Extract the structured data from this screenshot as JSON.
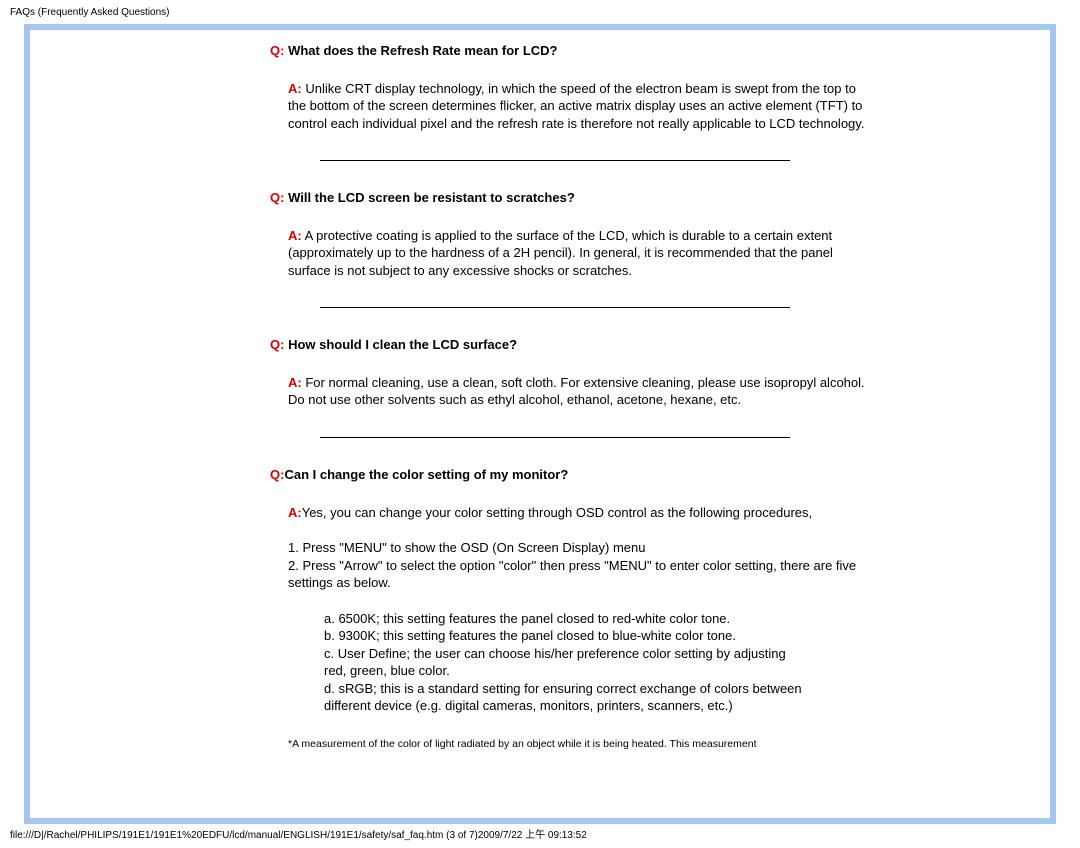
{
  "meta": {
    "top_note": "FAQs (Frequently Asked Questions)",
    "bottom_path": "file:///D|/Rachel/PHILIPS/191E1/191E1%20EDFU/lcd/manual/ENGLISH/191E1/safety/saf_faq.htm (3 of 7)2009/7/22 上午 09:13:52"
  },
  "labels": {
    "q_prefix": "Q:",
    "a_prefix": "A:"
  },
  "faq": [
    {
      "q": " What does the Refresh Rate mean for LCD?",
      "a": " Unlike CRT display technology, in which the speed of the electron beam is swept from the top to the bottom of the screen determines flicker, an active matrix display uses an active element (TFT) to control each individual pixel and the refresh rate is therefore not really applicable to LCD technology."
    },
    {
      "q": " Will the LCD screen be resistant to scratches?",
      "a": " A protective coating is applied to the surface of the LCD, which is durable to a certain extent (approximately up to the hardness of a 2H pencil). In general, it is recommended that the panel surface is not subject to any excessive shocks or scratches."
    },
    {
      "q": " How should I clean the LCD surface?",
      "a": " For normal cleaning, use a clean, soft cloth. For extensive cleaning, please use isopropyl alcohol. Do not use other solvents such as ethyl alcohol, ethanol, acetone, hexane, etc."
    },
    {
      "q": "Can I change the color setting of my monitor?",
      "a": "Yes, you can change your color setting through OSD control as the following procedures,",
      "steps": [
        "1. Press \"MENU\" to show the OSD (On Screen Display) menu",
        "2. Press \"Arrow\" to select the option \"color\" then press \"MENU\" to enter color setting, there are five settings as below."
      ],
      "substeps": [
        "a. 6500K; this setting features the panel closed to red-white color tone.",
        "b. 9300K; this setting features the panel closed to blue-white color tone.",
        "c. User Define; the user can choose his/her preference color setting by adjusting red, green, blue color.",
        "d. sRGB; this is a standard setting for ensuring correct exchange of colors between different device (e.g. digital cameras, monitors, printers, scanners, etc.)"
      ],
      "footnote": "*A measurement of the color of light radiated by an object while it is being heated. This measurement"
    }
  ]
}
